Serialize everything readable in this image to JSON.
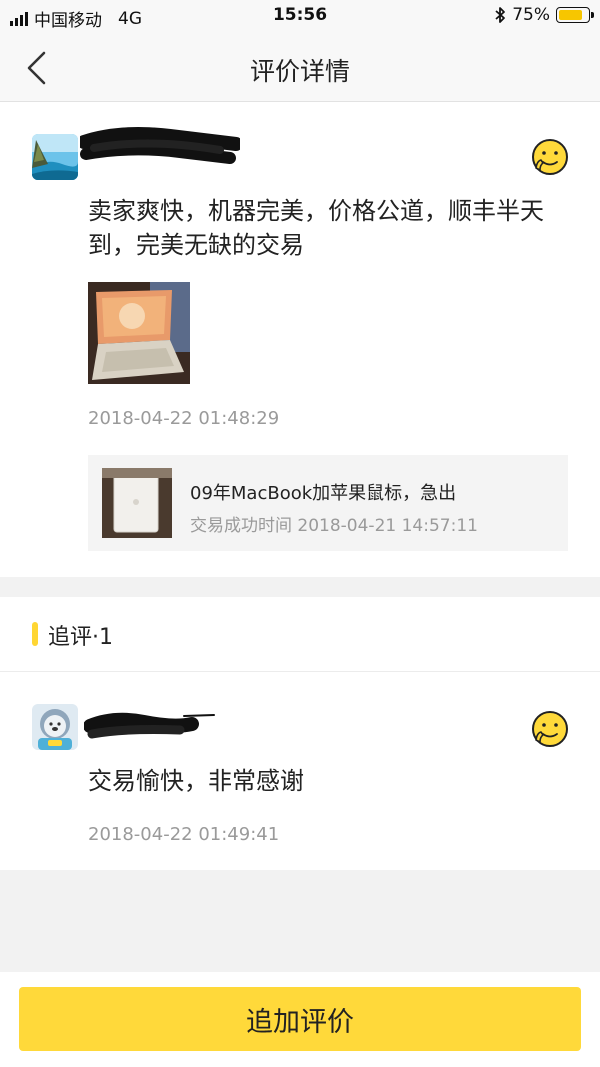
{
  "status_bar": {
    "carrier": "中国移动",
    "network": "4G",
    "time": "15:56",
    "battery_percent": "75%",
    "battery_level": 0.75,
    "icons": [
      "signal-icon",
      "bluetooth-icon",
      "battery-icon"
    ]
  },
  "nav": {
    "back_icon": "chevron-left-icon",
    "title": "评价详情"
  },
  "review": {
    "rating_icon": "emoji-face-icon",
    "text": "卖家爽快，机器完美，价格公道，顺丰半天到，完美无缺的交易",
    "timestamp": "2018-04-22 01:48:29",
    "item": {
      "title": "09年MacBook加苹果鼠标，急出",
      "trade_time": "交易成功时间 2018-04-21 14:57:11"
    }
  },
  "followup": {
    "label": "追评·1",
    "text": "交易愉快，非常感谢",
    "timestamp": "2018-04-22 01:49:41",
    "rating_icon": "emoji-face-icon"
  },
  "actions": {
    "add_review_label": "追加评价"
  },
  "colors": {
    "accent": "#ffd93a",
    "secondary_text": "#9a9a9a",
    "background": "#f2f2f2"
  }
}
